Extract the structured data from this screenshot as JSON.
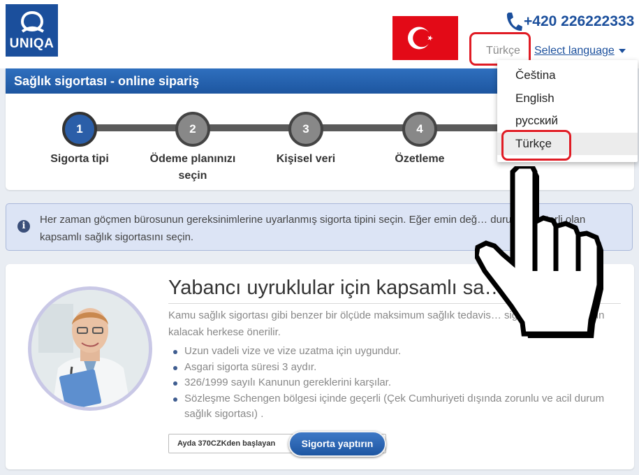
{
  "brand": {
    "logo_text": "UNIQA"
  },
  "header": {
    "phone": "+420 226222333",
    "current_language": "Türkçe",
    "select_language_label": "Select language"
  },
  "language_menu": {
    "options": [
      "Čeština",
      "English",
      "русский",
      "Türkçe"
    ],
    "selected": "Türkçe"
  },
  "order_panel": {
    "title": "Sağlık sigortası - online sipariş",
    "steps": [
      {
        "number": "1",
        "label": "Sigorta tipi",
        "active": true
      },
      {
        "number": "2",
        "label": "Ödeme planınızı seçin",
        "active": false
      },
      {
        "number": "3",
        "label": "Kişisel veri",
        "active": false
      },
      {
        "number": "4",
        "label": "Özetleme",
        "active": false
      }
    ]
  },
  "info": {
    "text": "Her zaman göçmen bürosunun gereksinimlerine uyarlanmış sigorta tipini seçin. Eğer emin değ… durumda yeterli olan kapsamlı sağlık sigortasını seçin."
  },
  "product": {
    "title": "Yabancı uyruklular için kapsamlı sa…",
    "description": "Kamu sağlık sigortası gibi benzer bir ölçüde maksimum sağlık tedavis… sigorta. 3 aydan uzun kalacak herkese önerilir.",
    "features": [
      "Uzun vadeli vize ve vize uzatma için uygundur.",
      "Asgari sigorta süresi 3 aydır.",
      "326/1999 sayılı Kanunun gereklerini karşılar.",
      "Sözleşme Schengen bölgesi içinde geçerli (Çek Cumhuriyeti dışında zorunlu ve acil durum sağlık sigortası) ."
    ],
    "price_label": "Ayda 370CZKden başlayan",
    "order_button": "Sigorta yaptırın"
  },
  "colors": {
    "brand_blue": "#1b4f9c",
    "highlight_red": "#e01b24",
    "flag_red": "#e30a17"
  }
}
